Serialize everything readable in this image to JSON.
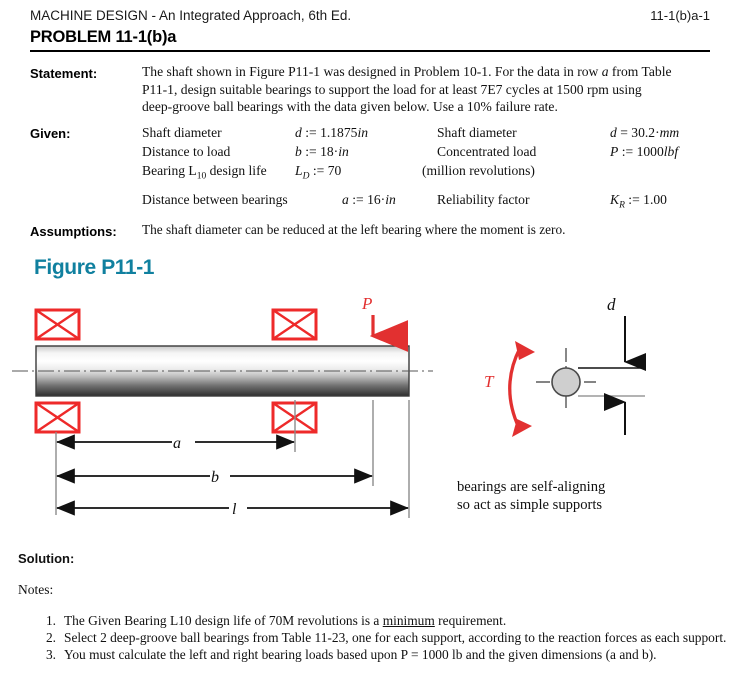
{
  "header": {
    "book_title": "MACHINE DESIGN - An Integrated Approach, 6th Ed.",
    "page_ref": "11-1(b)a-1"
  },
  "problem": {
    "title": "PROBLEM 11-1(b)a"
  },
  "sections": {
    "statement_label": "Statement:",
    "given_label": "Given:",
    "assumptions_label": "Assumptions:",
    "solution_label": "Solution:",
    "notes_label": "Notes:"
  },
  "statement": {
    "line1_a": "The shaft shown in Figure P11-1 was designed in Problem 10-1.  For the data in row ",
    "line1_var": "a",
    "line1_b": " from Table",
    "line2": "P11-1, design suitable bearings to support the load for at least 7E7 cycles at 1500 rpm using",
    "line3": "deep-groove ball bearings with the data given below.  Use a 10% failure rate."
  },
  "given": {
    "rows": [
      {
        "left_desc": "Shaft diameter",
        "left_sym": "d",
        "left_op": ":=",
        "left_val": "1.1875",
        "left_unit": "in",
        "right_desc": "Shaft diameter",
        "right_sym": "d",
        "right_op": "=",
        "right_val": "30.2",
        "right_unit": "mm"
      },
      {
        "left_desc": "Distance to load",
        "left_sym": "b",
        "left_op": ":=",
        "left_val": "18·",
        "left_unit": "in",
        "right_desc": "Concentrated load",
        "right_sym": "P",
        "right_op": ":=",
        "right_val": "1000",
        "right_unit": "lbf"
      }
    ],
    "life_desc_a": "Bearing L",
    "life_desc_sub": "10",
    "life_desc_b": " design life",
    "life_sym": "L",
    "life_sub": "D",
    "life_op": ":=",
    "life_val": "70",
    "life_note": "(million revolutions)",
    "between_desc": "Distance between bearings",
    "between_sym": "a",
    "between_op": ":=",
    "between_val": "16·",
    "between_unit": "in",
    "reliab_desc": "Reliability factor",
    "reliab_sym": "K",
    "reliab_sub": "R",
    "reliab_op": ":=",
    "reliab_val": "1.00"
  },
  "assumptions": {
    "text": "The shaft diameter can be reduced at the left bearing where the moment is zero."
  },
  "figure": {
    "title": "Figure P11-1",
    "title_color": "#10809f",
    "load_label": "P",
    "torque_label": "T",
    "diameter_label": "d",
    "dim_a": "a",
    "dim_b": "b",
    "dim_l": "l",
    "caption_line1": "bearings are self-aligning",
    "caption_line2": "so act as simple supports",
    "bearing_color": "#ee2a2a",
    "arrow_color": "#e23030",
    "shaft_light": "#ffffff",
    "shaft_dark": "#2b2b2b"
  },
  "notes": [
    {
      "num": "1.",
      "pre": "The Given Bearing L10 design life of 70M revolutions is a ",
      "underlined": "minimum",
      "post": " requirement."
    },
    {
      "num": "2.",
      "pre": "Select 2 deep-groove ball bearings from Table 11-23, one for each support, according to the reaction forces as each support.",
      "underlined": "",
      "post": ""
    },
    {
      "num": "3.",
      "pre": "You must calculate the left and right bearing loads based upon P = 1000 lb and the given dimensions (a and b).",
      "underlined": "",
      "post": ""
    }
  ]
}
